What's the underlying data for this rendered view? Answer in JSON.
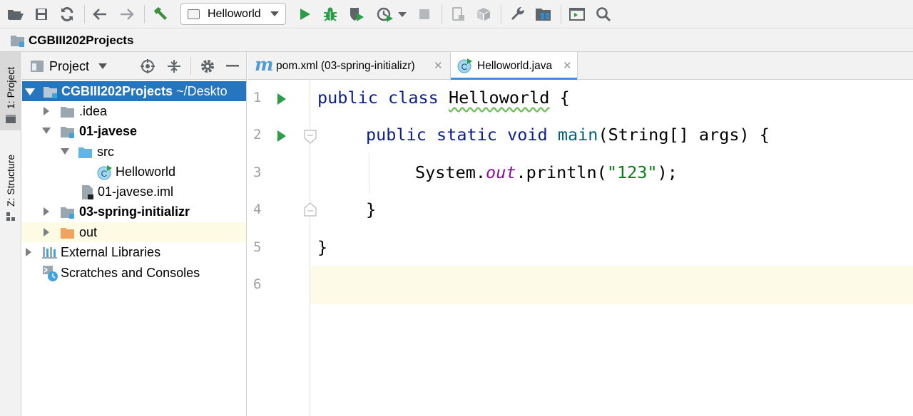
{
  "toolbar": {
    "run_config": "Helloworld",
    "icons": [
      "open-folder-icon",
      "save-icon",
      "sync-icon",
      "back-icon",
      "forward-icon",
      "build-hammer-icon",
      "run-icon",
      "debug-icon",
      "coverage-icon",
      "profile-icon",
      "stop-icon",
      "device-icon",
      "package-icon",
      "wrench-icon",
      "project-structure-icon",
      "terminal-icon",
      "search-icon"
    ]
  },
  "navbar": {
    "project_name": "CGBIII202Projects"
  },
  "left_strip": {
    "project_tab": "1: Project",
    "structure_tab": "Z: Structure"
  },
  "project_panel": {
    "title": "Project",
    "tree": [
      {
        "label": "CGBIII202Projects",
        "suffix": " ~/Deskto"
      },
      {
        "label": ".idea"
      },
      {
        "label": "01-javese"
      },
      {
        "label": "src"
      },
      {
        "label": "Helloworld"
      },
      {
        "label": "01-javese.iml"
      },
      {
        "label": "03-spring-initializr"
      },
      {
        "label": "out"
      },
      {
        "label": "External Libraries"
      },
      {
        "label": "Scratches and Consoles"
      }
    ]
  },
  "editor": {
    "tabs": [
      {
        "label": "pom.xml (03-spring-initializr)",
        "icon_letter": "m"
      },
      {
        "label": "Helloworld.java",
        "icon_letter": "C"
      }
    ],
    "line_numbers": [
      "1",
      "2",
      "3",
      "4",
      "5",
      "6"
    ],
    "code": {
      "l1": {
        "kw1": "public",
        "kw2": "class",
        "name": "Helloworld",
        "brace": "{"
      },
      "l2": {
        "kw1": "public",
        "kw2": "static",
        "kw3": "void",
        "method": "main",
        "rest": "(String[] args) {"
      },
      "l3": {
        "obj": "System.",
        "field": "out",
        "call": ".println(",
        "str": "\"123\"",
        "end": ");"
      },
      "l4": "}",
      "l5": "}"
    }
  },
  "colors": {
    "keyword": "#0b1e8f",
    "method": "#00627a",
    "field": "#871094",
    "string": "#067d17",
    "selection": "#2675bf",
    "run_green": "#2a9d46"
  }
}
